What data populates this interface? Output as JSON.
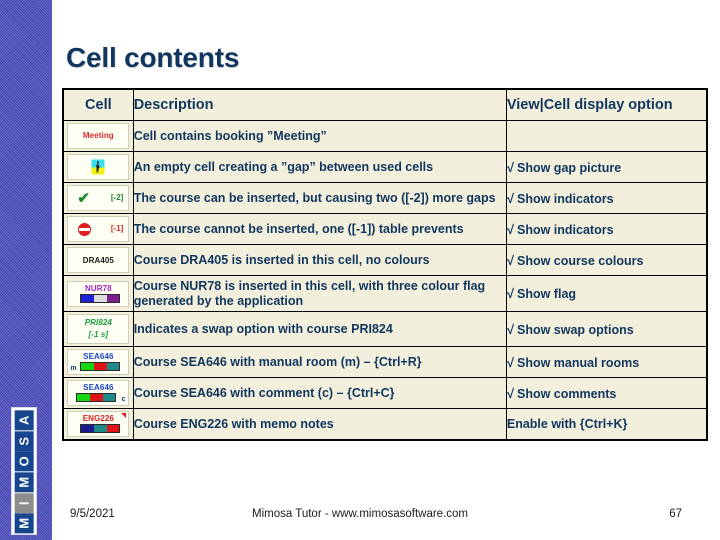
{
  "slide": {
    "title": "Cell contents",
    "logo_letters": [
      "M",
      "I",
      "M",
      "O",
      "S",
      "A"
    ],
    "logo_dim_index": 1
  },
  "table": {
    "headers": {
      "cell": "Cell",
      "description": "Description",
      "option": "View|Cell display option"
    },
    "rows": [
      {
        "icon": "booking-meeting",
        "icon_text": "Meeting",
        "description": "Cell contains booking ”Meeting”",
        "option": "",
        "option_checked": false
      },
      {
        "icon": "gap-picture",
        "icon_text": "",
        "description": "An empty cell creating a ”gap” between used cells",
        "option": "Show gap picture",
        "option_checked": true
      },
      {
        "icon": "green-check-indicator",
        "icon_text": "[-2]",
        "description": "The course can be inserted, but causing two ([-2]) more gaps",
        "option": "Show indicators",
        "option_checked": true
      },
      {
        "icon": "no-entry-indicator",
        "icon_text": "[-1]",
        "description": "The course cannot be inserted, one ([-1]) table prevents",
        "option": "Show indicators",
        "option_checked": true
      },
      {
        "icon": "course-plain",
        "icon_text": "DRA405",
        "description": "Course DRA405 is inserted in this cell, no colours",
        "option": "Show course colours",
        "option_checked": true
      },
      {
        "icon": "course-flag",
        "icon_text": "NUR78",
        "description": "Course NUR78 is inserted in this cell, with three colour flag generated by the application",
        "option": "Show flag",
        "option_checked": true
      },
      {
        "icon": "swap-option",
        "icon_text": "PRI824",
        "icon_text2": "[-1 s]",
        "description": "Indicates a swap option with course PRI824",
        "option": "Show swap options",
        "option_checked": true
      },
      {
        "icon": "manual-room",
        "icon_text": "SEA646",
        "marker": "m",
        "description": "Course SEA646 with manual room (m) – {Ctrl+R}",
        "option": "Show manual rooms",
        "option_checked": true
      },
      {
        "icon": "comment",
        "icon_text": "SEA646",
        "marker": "c",
        "description": "Course SEA646 with comment (c) – {Ctrl+C}",
        "option": "Show comments",
        "option_checked": true
      },
      {
        "icon": "memo-notes",
        "icon_text": "ENG226",
        "description": "Course ENG226 with memo notes",
        "option": "Enable with {Ctrl+K}",
        "option_checked": false
      }
    ],
    "check_glyph": "√"
  },
  "footer": {
    "date": "9/5/2021",
    "center": "Mimosa Tutor - www.mimosasoftware.com",
    "page": "67"
  },
  "colors": {
    "title": "#11365e",
    "table_bg": "#f2efdc",
    "sidebar": "#4d4dc4",
    "logo_blue": "#17468f"
  }
}
